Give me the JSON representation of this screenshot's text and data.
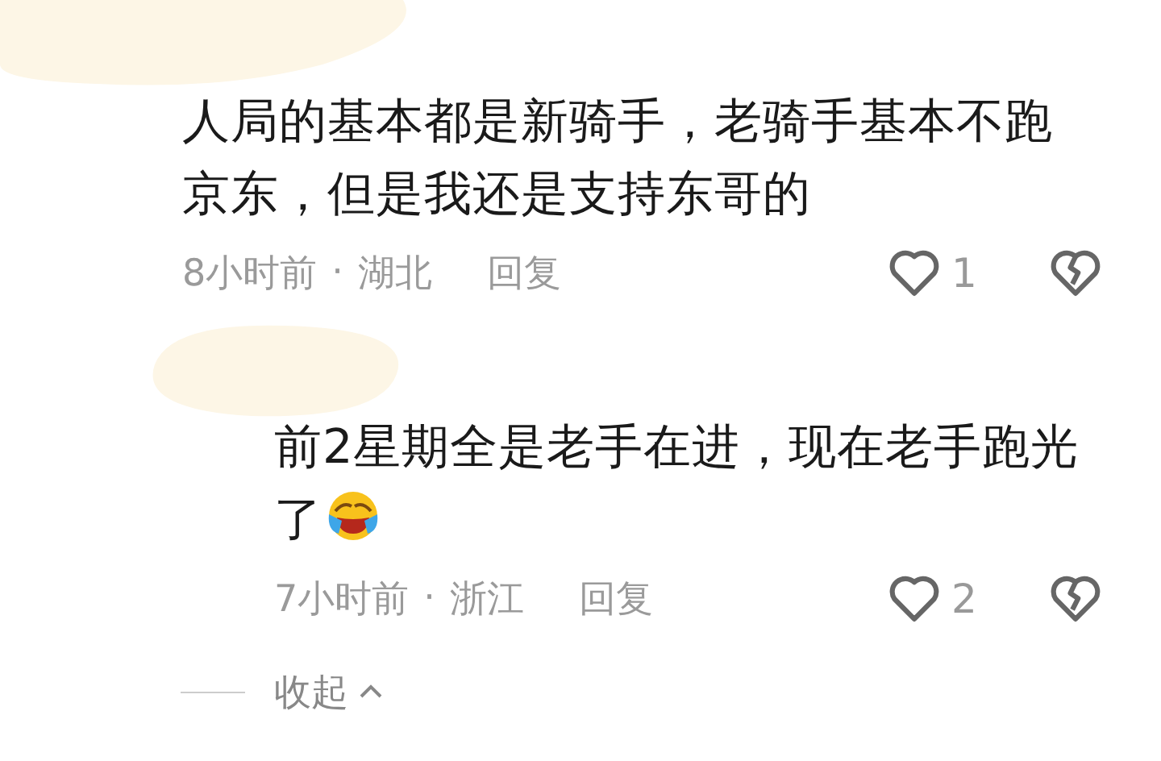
{
  "comments": [
    {
      "text": "人局的基本都是新骑手，老骑手基本不跑京东，但是我还是支持东哥的",
      "has_emoji": false,
      "time": "8小时前",
      "separator": "·",
      "location": "湖北",
      "reply": "回复",
      "likes": "1",
      "kind": "comment"
    },
    {
      "text": "前2星期全是老手在进，现在老手跑光了",
      "has_emoji": true,
      "time": "7小时前",
      "separator": "·",
      "location": "浙江",
      "reply": "回复",
      "likes": "2",
      "kind": "reply"
    }
  ],
  "collapse": {
    "label": "收起"
  }
}
